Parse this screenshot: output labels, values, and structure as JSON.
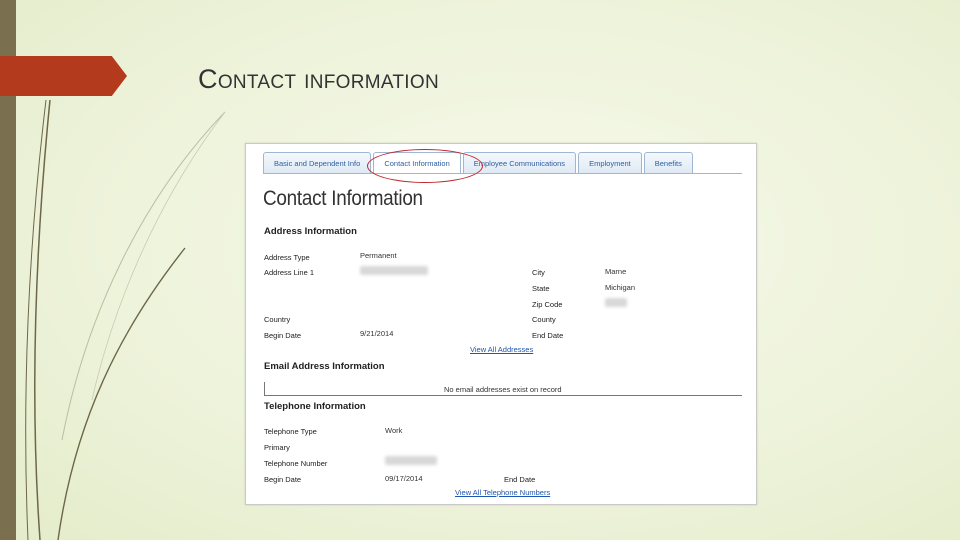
{
  "slide": {
    "title": "Contact Information"
  },
  "tabs": [
    {
      "label": "Basic and Dependent Info"
    },
    {
      "label": "Contact Information"
    },
    {
      "label": "Employee Communications"
    },
    {
      "label": "Employment"
    },
    {
      "label": "Benefits"
    }
  ],
  "page": {
    "title": "Contact Information",
    "address": {
      "heading": "Address Information",
      "address_type_label": "Address Type",
      "address_type_value": "Permanent",
      "address_line_label": "Address Line 1",
      "city_label": "City",
      "city_value": "Marne",
      "state_label": "State",
      "state_value": "Michigan",
      "zip_label": "Zip Code",
      "country_label": "Country",
      "county_label": "County",
      "begin_date_label": "Begin Date",
      "begin_date_value": "9/21/2014",
      "end_date_label": "End Date",
      "view_all_link": "View All Addresses"
    },
    "email": {
      "heading": "Email Address Information",
      "empty_message": "No email addresses exist on record"
    },
    "telephone": {
      "heading": "Telephone Information",
      "type_label": "Telephone Type",
      "type_value": "Work",
      "primary_label": "Primary",
      "number_label": "Telephone Number",
      "begin_date_label": "Begin Date",
      "begin_date_value": "09/17/2014",
      "end_date_label": "End Date",
      "view_all_link": "View All Telephone Numbers"
    }
  },
  "colors": {
    "accent": "#b33a1c",
    "sidebar": "#7a7050",
    "link": "#1e56b0",
    "callout": "#c0282f"
  }
}
